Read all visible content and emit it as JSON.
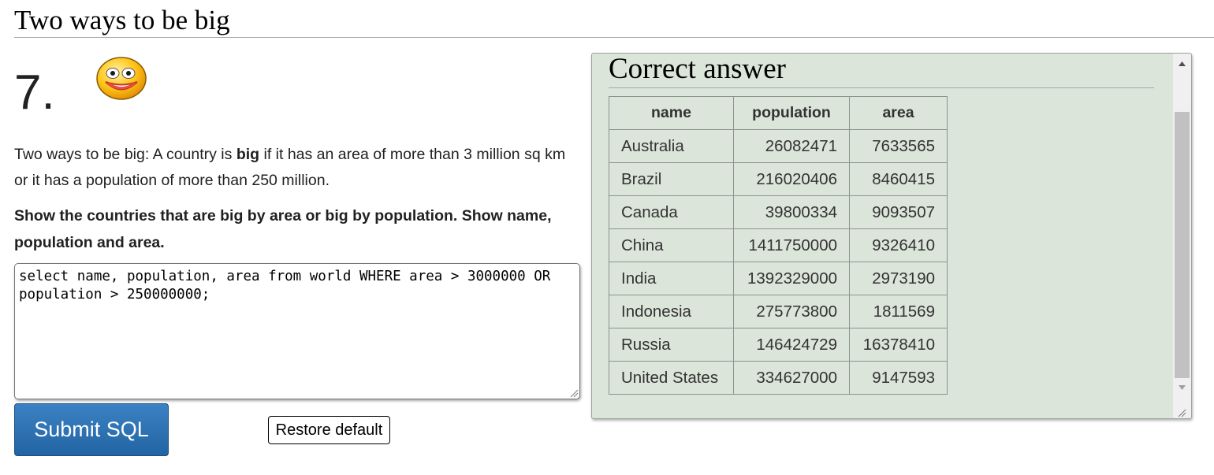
{
  "page": {
    "heading": "Two ways to be big"
  },
  "question": {
    "number": "7.",
    "intro_parts": [
      "Two ways to be big: A country is ",
      "big",
      " if it has an area of more than 3 million sq km or it has a population of more than 250 million."
    ],
    "task": "Show the countries that are big by area or big by population. Show name, population and area.",
    "sql": "select name, population, area from world WHERE area > 3000000 OR\npopulation > 250000000;"
  },
  "buttons": {
    "submit": "Submit SQL",
    "restore": "Restore default"
  },
  "answer": {
    "title": "Correct answer",
    "columns": [
      "name",
      "population",
      "area"
    ],
    "rows": [
      [
        "Australia",
        "26082471",
        "7633565"
      ],
      [
        "Brazil",
        "216020406",
        "8460415"
      ],
      [
        "Canada",
        "39800334",
        "9093507"
      ],
      [
        "China",
        "1411750000",
        "9326410"
      ],
      [
        "India",
        "1392329000",
        "2973190"
      ],
      [
        "Indonesia",
        "275773800",
        "1811569"
      ],
      [
        "Russia",
        "146424729",
        "16378410"
      ],
      [
        "United States",
        "334627000",
        "9147593"
      ]
    ]
  },
  "icons": {
    "smiley": "smiley-face-icon"
  },
  "colors": {
    "submit_button": "#2a6fb0",
    "answer_panel": "#dbe5d9",
    "smiley": "#ffc61a"
  }
}
